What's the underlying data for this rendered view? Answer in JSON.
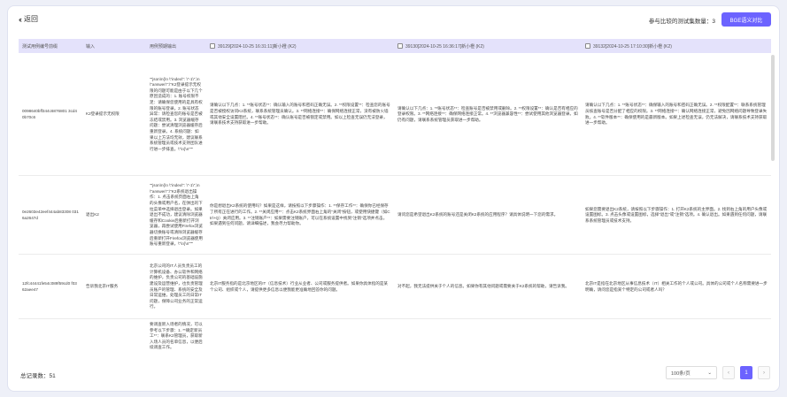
{
  "header": {
    "back_label": "返回",
    "set_count_label": "参与比较的测试集数量：",
    "set_count_value": "3",
    "compare_button": "BGE语义对比"
  },
  "table": {
    "columns": [
      "测试用例编号前缀",
      "输入",
      "用例预期输出",
      "39129[2024-10-25 16:31:11]新小橙 (K2)",
      "39130[2024-10-25 16:36:17]新小橙 (K2)",
      "39132[2024-10-25 17:10:30]新小橙 (K2)"
    ],
    "rows": [
      {
        "id": "0098640bff344c6876801 3cd40b70c6",
        "input": "K2登录提示无权限",
        "expected": "\"\"json\\n{\\n \\\"index\\\": \\\"-1\\\",\\n \\\"answer\\\":\\\"K2登录提示无权限的问题可能是由于以下几个原因造成的：1. 账号权限不足：请确保您使用的是具有权限的账号登录。2. 账号状态异常：请检查您的账号是否被冻结或禁用。3. 浏览器缓存问题：尝试清理浏览器缓存后重新登录。4. 系统问题：如果以上方法均无效，建议联系系统管理员或技术支持团队进行进一步排查。\\\"\\n}\\n\"\"\"",
        "r1": "请确认以下几点：1. **账号状态**：确认输入的账号和密码正确无误。2. **权限设置**：检查您的账号是否被授权访问K2系统，联系系统管理员确认。3. **网络连接**：确保网络连接正常，没有被防火墙或其他安全设置阻拦。4. **账号状态**：确认账号是否被锁定或禁用。如以上检查无误仍无法登录，请联系技术支持获取进一步帮助。",
        "r2": "请确认以下几点：1. **账号状态**：检查账号是否被禁用或删除。2. **权限设置**：确认是否有相应的登录权限。3. **网络连接**：确保网络连接正常。4. **浏览器兼容性**：尝试使用其他浏览器登录。如仍有问题，请联系系统管理员获取进一步帮助。",
        "r3": "请确认以下几点：1. **账号状态**：确保输入的账号和密码正确无误。2. **权限配置**：联系系统管理员核查账号是否分配了相应的权限。3. **网络连接**：确认网络连接正常，避免因网络问题导致登录失败。4. **软件版本**：确保使用的是最新版本。如果上述检查无误，仍无法解决，请联系技术支持获取进一步帮助。"
      },
      {
        "id": "0e2603e42eef444ab83308 0316a2647d",
        "input": "退出K2",
        "expected": "\"\"json\\n{\\n \\\"index\\\": \\\"-1\\\",\\n \\\"answer\\\":\\\"K2系统退出操作：1. 点击系统页面右上角的头像或用户名，在弹出的下拉菜单中选择退出登录。如果退出不成功，建议清除浏览器缓存和Cookie后重新打开浏览器，再尝试使用Firefox浏览器切换账号或清除浏览器缓存后重新打开Firefox浏览器使用账号重新登录。\\\"\\n}\\n\"\"\"",
        "r1": "你是想退出K2系统的使用吗？如果是这样，请按照以下步骤操作：1. **保存工作**：确保你已经保存了所有正在进行的工作。2. **关闭应用**：点击K2系统界面右上角的\"关闭\"按钮，或使用快捷键（如Ctrl+Q）关闭应用。3. **注销账户**：如果需要注销账户，可以在系统设置中找到\"注销\"选项并点击。如果遇到任何问题，请详细描述，我会尽力帮助你。",
        "r2": "请问您是希望退出K2系统的账号还是关闭K2系统的应用程序？请具体说明一下您的需求。",
        "r3": "如果您需要退出K2系统，请按照以下步骤操作：1. 打开K2系统的主界面。2. 找到右上角的用户头像或设置图标。3. 点击头像或设置图标，选择\"退出\"或\"注销\"选项。4. 确认退出。如果遇到任何问题，请联系系统管理员或技术支持。"
      },
      {
        "id": "12fc44441fe54c089f59cd0 f0362aee47",
        "input": "告诉我北京IT服务",
        "expected": "北京公司的IT人员负责员工的计算机设备、办公软件和网络的维护，负责公司的基础设施建设及运营维护，也负责管理员账户的管理、系统的安全及日常运维，处理员工的日常IT问题，保障公司业务的正常运行。",
        "r1": "北京IT服务指的是北京地区的IT（信息技术）行业从业者、公司或服务提供者。如果你具体指的是某个公司、组织或个人，请提供更多信息以便我能更准确地回答你的问题。",
        "r2": "对不起，我无法提供关于个人的信息。如果你有其他问题或需要关于K2系统的帮助，请告诉我。",
        "r3": "北京IT是指在北京地区从事信息技术（IT）相关工作的个人或公司。具体的公司或个人名称需要进一步明确，请问您是指某个特定的公司或者人吗？"
      },
      {
        "id": "",
        "input": "",
        "expected": "要调查新入场者的情况，可以参考以下步骤：1. **确定新员工**：联系K2管理员，获取新入场人员的名单信息，以便后续调查工作。",
        "r1": "",
        "r2": "",
        "r3": ""
      }
    ]
  },
  "footer": {
    "total_label": "总记录数：",
    "total_value": "51",
    "page_size": "100条/页",
    "prev": "‹",
    "current_page": "1",
    "next": "›"
  }
}
